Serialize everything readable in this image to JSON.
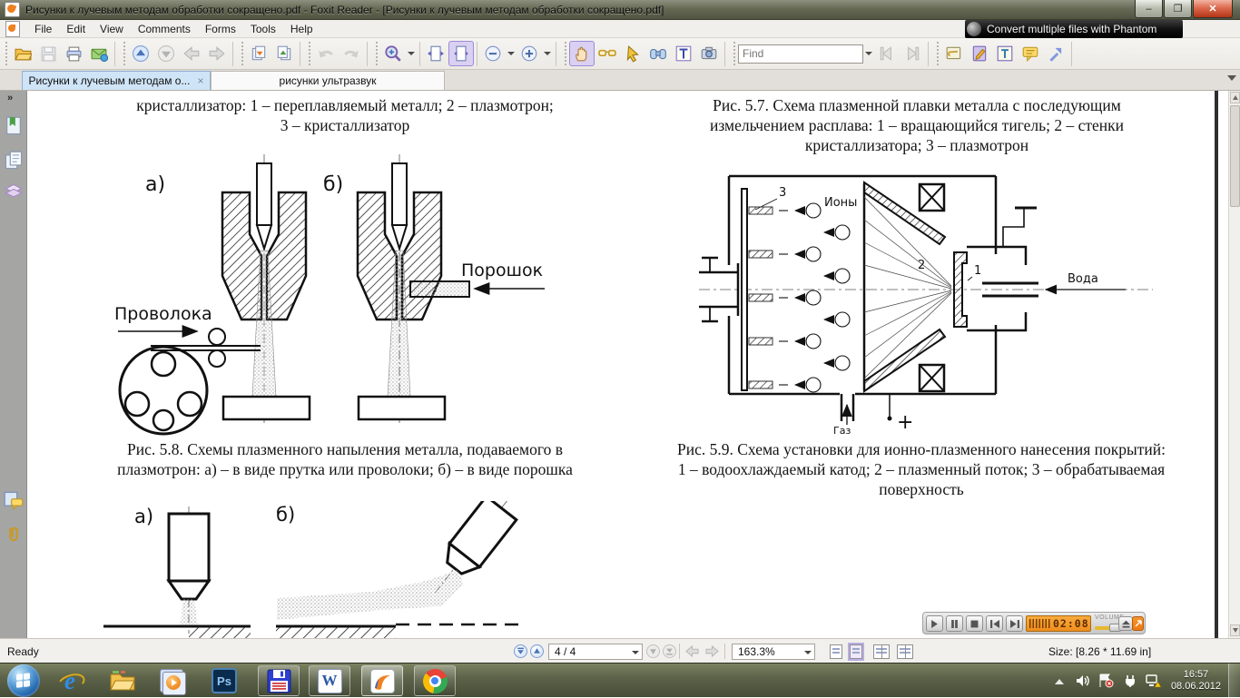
{
  "window": {
    "title": "Рисунки к лучевым методам обработки сокращено.pdf - Foxit Reader - [Рисунки к лучевым методам обработки сокращено.pdf]",
    "ad_banner": "Convert multiple files with Phantom",
    "minimize": "–",
    "restore": "❐",
    "close": "✕"
  },
  "menu": {
    "items": [
      "File",
      "Edit",
      "View",
      "Comments",
      "Forms",
      "Tools",
      "Help"
    ]
  },
  "toolbar": {
    "find_placeholder": "Find"
  },
  "tabs": {
    "active": "Рисунки к лучевым методам о...",
    "active_close": "×",
    "inactive": "рисунки ультразвук"
  },
  "sidebar_chevron": "»",
  "document": {
    "caption_56": {
      "line1": "кристаллизатор: 1 – переплавляемый металл; 2 – плазмотрон;",
      "line2": "3 – кристаллизатор"
    },
    "caption_57": {
      "line1": "Рис. 5.7. Схема плазменной плавки металла с последующим",
      "line2": "измельчением расплава: 1 – вращающийся тигель; 2 – стенки",
      "line3": "кристаллизатора; 3 – плазмотрон"
    },
    "caption_58": {
      "line1": "Рис. 5.8. Схемы плазменного напыления металла, подаваемого в",
      "line2": "плазмотрон: а) – в виде прутка или проволоки; б) – в виде порошка"
    },
    "caption_59": {
      "line1": "Рис. 5.9. Схема установки для ионно-плазменного нанесения покрытий:",
      "line2": "1 – водоохлаждаемый катод; 2 – плазменный поток; 3 – обрабатываемая",
      "line3": "поверхность"
    },
    "fig58": {
      "label_a": "а)",
      "label_b": "б)",
      "wire_label": "Проволока",
      "powder_label": "Порошок"
    },
    "fig59": {
      "ions_label": "Ионы",
      "water_label": "Вода",
      "gas_label": "Газ",
      "num1": "1",
      "num2": "2",
      "num3": "3",
      "plus": "+"
    },
    "fig510": {
      "label_a": "а)",
      "label_b": "б)"
    }
  },
  "player": {
    "time": "02:08",
    "volume_label": "VOLUME"
  },
  "statusbar": {
    "ready": "Ready",
    "page": "4 / 4",
    "zoom": "163.3%",
    "size": "Size: [8.26 * 11.69 in]"
  },
  "tray": {
    "time": "16:57",
    "date": "08.06.2012"
  },
  "colors": {
    "active_tab": "#cfe4f7",
    "pressed_tool": "#d9d0f2",
    "lcd_orange": "#f29a2e",
    "taskbar_olive": "#5d644a",
    "close_red": "#b33518"
  }
}
